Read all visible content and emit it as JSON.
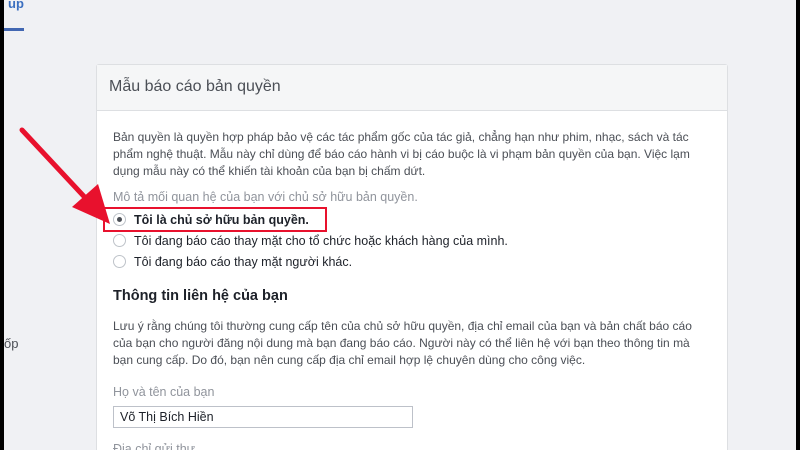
{
  "nav": {
    "fragment_label": "up"
  },
  "sidebar": {
    "fragment_label": "ốp"
  },
  "form": {
    "title": "Mẫu báo cáo bản quyền",
    "intro": "Bản quyền là quyền hợp pháp bảo vệ các tác phẩm gốc của tác giả, chẳng hạn như phim, nhạc, sách và tác phẩm nghệ thuật. Mẫu này chỉ dùng để báo cáo hành vi bị cáo buộc là vi phạm bản quyền của bạn. Việc lạm dụng mẫu này có thể khiến tài khoản của bạn bị chấm dứt.",
    "relationship_question": "Mô tả mối quan hệ của bạn với chủ sở hữu bản quyền.",
    "options": [
      {
        "label": "Tôi là chủ sở hữu bản quyền.",
        "selected": true
      },
      {
        "label": "Tôi đang báo cáo thay mặt cho tổ chức hoặc khách hàng của mình.",
        "selected": false
      },
      {
        "label": "Tôi đang báo cáo thay mặt người khác.",
        "selected": false
      }
    ],
    "contact_heading": "Thông tin liên hệ của bạn",
    "contact_notice": "Lưu ý rằng chúng tôi thường cung cấp tên của chủ sở hữu quyền, địa chỉ email của bạn và bản chất báo cáo của bạn cho người đăng nội dung mà bạn đang báo cáo. Người này có thể liên hệ với bạn theo thông tin mà bạn cung cấp. Do đó, bạn nên cung cấp địa chỉ email hợp lệ chuyên dùng cho công việc.",
    "name_label": "Họ và tên của bạn",
    "name_value": "Võ Thị Bích Hiền",
    "address_label": "Địa chỉ gửi thư"
  },
  "colors": {
    "annotation_red": "#e8112d",
    "brand_blue": "#4267b2"
  }
}
